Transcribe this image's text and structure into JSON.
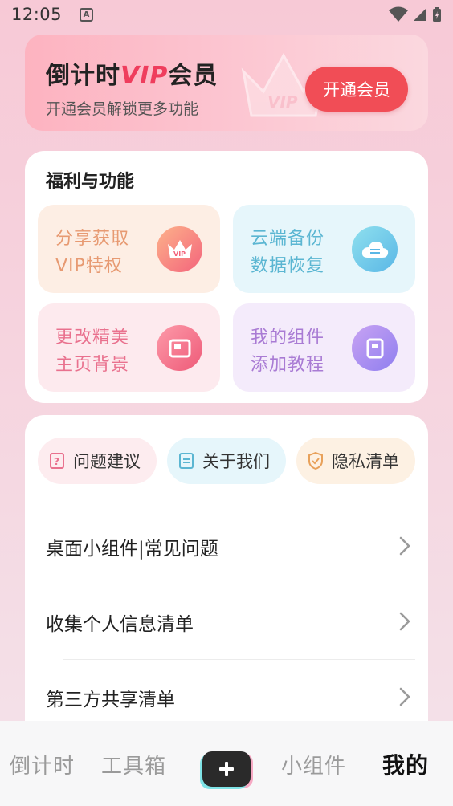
{
  "status_bar": {
    "time": "12:05",
    "notification_glyph": "A"
  },
  "vip_banner": {
    "title_prefix": "倒计时",
    "title_vip": "VIP",
    "title_suffix": "会员",
    "subtitle": "开通会员解锁更多功能",
    "button": "开通会员",
    "crown_text": "VIP"
  },
  "features": {
    "heading": "福利与功能",
    "tiles": [
      {
        "line1": "分享获取",
        "line2": "VIP特权",
        "icon": "vip-crown-icon",
        "icon_text": "VIP"
      },
      {
        "line1": "云端备份",
        "line2": "数据恢复",
        "icon": "cloud-icon"
      },
      {
        "line1": "更改精美",
        "line2": "主页背景",
        "icon": "picture-icon"
      },
      {
        "line1": "我的组件",
        "line2": "添加教程",
        "icon": "widget-icon"
      }
    ]
  },
  "quick_links": [
    {
      "label": "问题建议",
      "icon": "question-icon",
      "color": "#e9718e"
    },
    {
      "label": "关于我们",
      "icon": "document-icon",
      "color": "#5bb6d2"
    },
    {
      "label": "隐私清单",
      "icon": "shield-check-icon",
      "color": "#e8a15a"
    }
  ],
  "menu_rows": [
    {
      "label": "桌面小组件|常见问题"
    },
    {
      "label": "收集个人信息清单"
    },
    {
      "label": "第三方共享清单"
    }
  ],
  "bottom_nav": {
    "countdown": "倒计时",
    "tools": "工具箱",
    "widgets": "小组件",
    "mine": "我的"
  }
}
